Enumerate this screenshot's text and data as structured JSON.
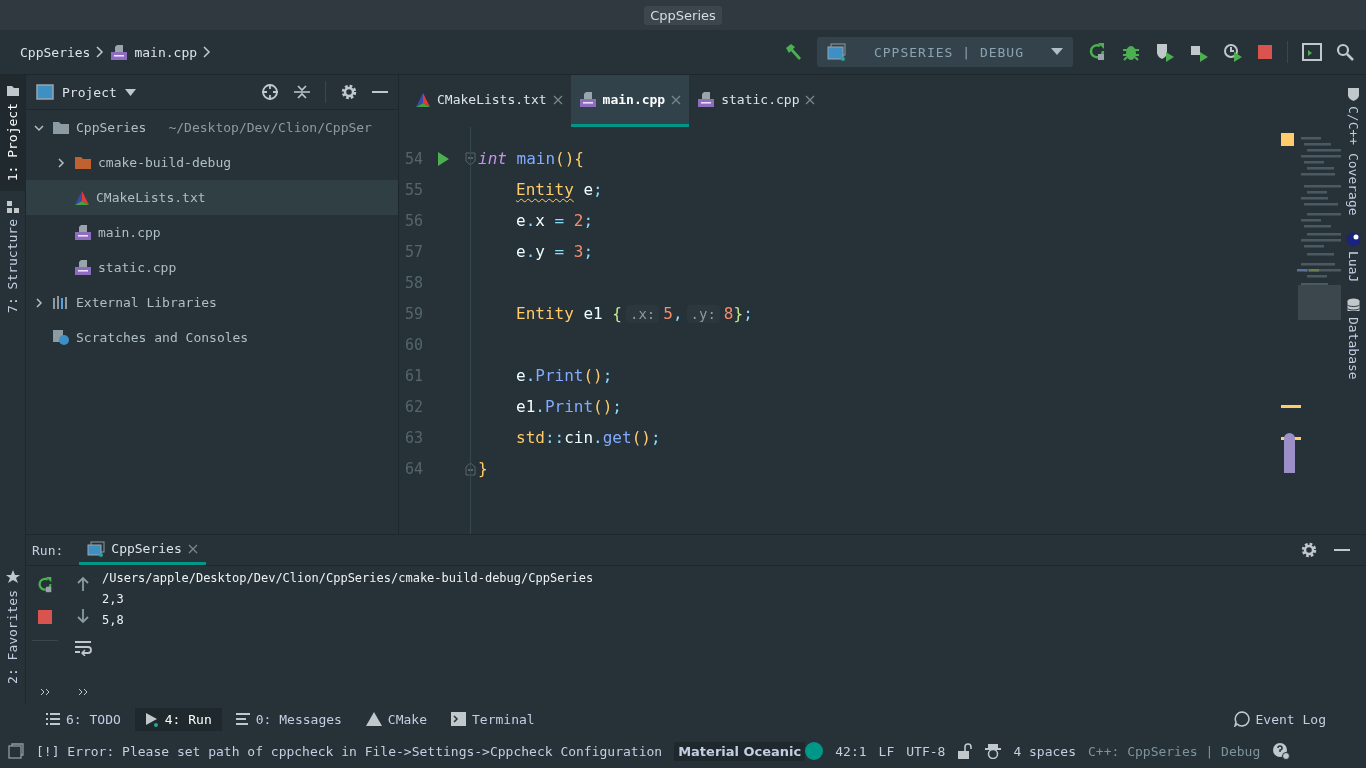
{
  "window": {
    "title": "CppSeries"
  },
  "breadcrumbs": [
    {
      "label": "CppSeries",
      "kind": "project"
    },
    {
      "label": "main.cpp",
      "kind": "cpp"
    }
  ],
  "run_config": {
    "label": "CPPSERIES | DEBUG"
  },
  "left_tool_windows": [
    {
      "label": "1: Project",
      "kind": "project",
      "selected": true
    },
    {
      "label": "7: Structure",
      "kind": "structure",
      "selected": false
    }
  ],
  "project_panel": {
    "title": "Project",
    "tree": [
      {
        "label": "CppSeries",
        "path": "~/Desktop/Dev/Clion/CppSer",
        "kind": "folder",
        "expanded": true,
        "selected": false,
        "children": [
          {
            "label": "cmake-build-debug",
            "kind": "build-folder",
            "expanded": false,
            "selected": false
          },
          {
            "label": "CMakeLists.txt",
            "kind": "cmake",
            "selected": true
          },
          {
            "label": "main.cpp",
            "kind": "cpp",
            "selected": false
          },
          {
            "label": "static.cpp",
            "kind": "cpp",
            "selected": false
          }
        ]
      },
      {
        "label": "External Libraries",
        "kind": "libraries",
        "expanded": false,
        "selected": false
      },
      {
        "label": "Scratches and Consoles",
        "kind": "scratches",
        "selected": false
      }
    ]
  },
  "editor_tabs": [
    {
      "label": "CMakeLists.txt",
      "kind": "cmake",
      "selected": false
    },
    {
      "label": "main.cpp",
      "kind": "cpp",
      "selected": true
    },
    {
      "label": "static.cpp",
      "kind": "cpp",
      "selected": false
    }
  ],
  "code_lines": [
    {
      "number": "54",
      "run_marker": true,
      "fold_open": true,
      "indented": false,
      "tokens": [
        {
          "kind": "keyword",
          "text": "int"
        },
        {
          "kind": "function",
          "text": " main"
        },
        {
          "kind": "paren",
          "text": "(){"
        }
      ]
    },
    {
      "number": "55",
      "indented": true,
      "tokens": [
        {
          "kind": "type",
          "text": "Entity",
          "warning": true
        },
        {
          "kind": "name",
          "text": " e"
        },
        {
          "kind": "punct",
          "text": ";"
        }
      ]
    },
    {
      "number": "56",
      "indented": true,
      "tokens": [
        {
          "kind": "name",
          "text": "e"
        },
        {
          "kind": "punct",
          "text": "."
        },
        {
          "kind": "name",
          "text": "x "
        },
        {
          "kind": "punct",
          "text": "= "
        },
        {
          "kind": "number",
          "text": "2"
        },
        {
          "kind": "punct",
          "text": ";"
        }
      ]
    },
    {
      "number": "57",
      "indented": true,
      "tokens": [
        {
          "kind": "name",
          "text": "e"
        },
        {
          "kind": "punct",
          "text": "."
        },
        {
          "kind": "name",
          "text": "y "
        },
        {
          "kind": "punct",
          "text": "= "
        },
        {
          "kind": "number",
          "text": "3"
        },
        {
          "kind": "punct",
          "text": ";"
        }
      ]
    },
    {
      "number": "58"
    },
    {
      "number": "59",
      "indented": true,
      "tokens": [
        {
          "kind": "type",
          "text": "Entity"
        },
        {
          "kind": "name",
          "text": " e1 "
        },
        {
          "kind": "brace",
          "text": "{"
        },
        {
          "kind": "hint",
          "text": ".x:"
        },
        {
          "kind": "number",
          "text": "5"
        },
        {
          "kind": "punct",
          "text": ","
        },
        {
          "kind": "hint",
          "text": ".y:"
        },
        {
          "kind": "number",
          "text": "8"
        },
        {
          "kind": "brace",
          "text": "}"
        },
        {
          "kind": "punct",
          "text": ";"
        }
      ]
    },
    {
      "number": "60"
    },
    {
      "number": "61",
      "indented": true,
      "tokens": [
        {
          "kind": "name",
          "text": "e"
        },
        {
          "kind": "punct",
          "text": "."
        },
        {
          "kind": "function",
          "text": "Print"
        },
        {
          "kind": "paren",
          "text": "()"
        },
        {
          "kind": "punct",
          "text": ";"
        }
      ]
    },
    {
      "number": "62",
      "indented": true,
      "tokens": [
        {
          "kind": "name",
          "text": "e1"
        },
        {
          "kind": "punct",
          "text": "."
        },
        {
          "kind": "function",
          "text": "Print"
        },
        {
          "kind": "paren",
          "text": "()"
        },
        {
          "kind": "punct",
          "text": ";"
        }
      ]
    },
    {
      "number": "63",
      "indented": true,
      "tokens": [
        {
          "kind": "paren",
          "text": "std"
        },
        {
          "kind": "punct",
          "text": "::"
        },
        {
          "kind": "name",
          "text": "cin"
        },
        {
          "kind": "punct",
          "text": "."
        },
        {
          "kind": "function",
          "text": "get"
        },
        {
          "kind": "paren",
          "text": "()"
        },
        {
          "kind": "punct",
          "text": ";"
        }
      ]
    },
    {
      "number": "64",
      "fold_close": true,
      "indented": false,
      "tokens": [
        {
          "kind": "paren",
          "text": "}"
        }
      ]
    }
  ],
  "right_tool_windows": [
    {
      "label": "C/C++ Coverage",
      "kind": "coverage"
    },
    {
      "label": "LuaJ",
      "kind": "luaj"
    },
    {
      "label": "Database",
      "kind": "database"
    }
  ],
  "run_panel": {
    "title": "Run:",
    "tab": {
      "label": "CppSeries",
      "selected": true
    },
    "output": [
      {
        "t": "/Users/apple/Desktop/Dev/Clion/CppSeries/cmake-build-debug/CppSeries"
      },
      {
        "t": "2,3"
      },
      {
        "t": "5,8"
      }
    ]
  },
  "favorites": {
    "label": "2: Favorites"
  },
  "tool_tabs": [
    {
      "label": "6: TODO",
      "kind": "todo",
      "selected": false
    },
    {
      "label": "4: Run",
      "kind": "run",
      "selected": true
    },
    {
      "label": "0: Messages",
      "kind": "messages",
      "selected": false
    },
    {
      "label": "CMake",
      "kind": "cmake",
      "selected": false
    },
    {
      "label": "Terminal",
      "kind": "terminal",
      "selected": false
    }
  ],
  "event_log": {
    "label": "Event Log"
  },
  "status_bar": {
    "message": "[!] Error: Please set path of cppcheck in File->Settings->Cppcheck Configuration",
    "theme": "Material Oceanic",
    "position": "42:1",
    "line_separator": "LF",
    "encoding": "UTF-8",
    "indent": "4 spaces",
    "context": "C++: CppSeries | Debug"
  }
}
